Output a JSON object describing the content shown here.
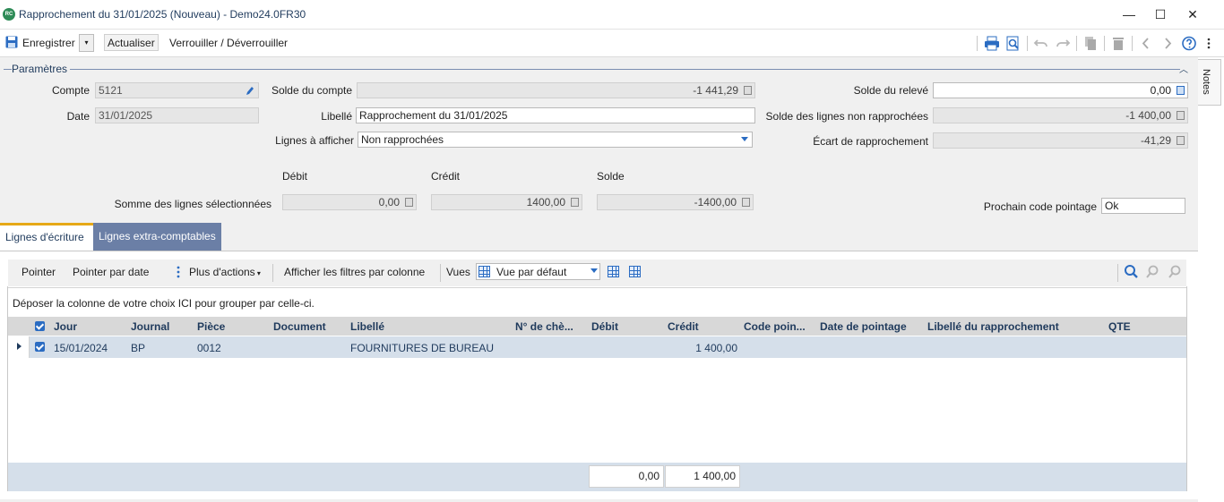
{
  "window": {
    "logo_text": "RC",
    "title": "Rapprochement du 31/01/2025 (Nouveau) - Demo24.0FR30",
    "controls": [
      "—",
      "☐",
      "✕"
    ]
  },
  "toolbar": {
    "save_label": "Enregistrer",
    "refresh_label": "Actualiser",
    "lock_label": "Verrouiller / Déverrouiller"
  },
  "notes": {
    "label": "Notes"
  },
  "params": {
    "section_title": "Paramètres",
    "compte_label": "Compte",
    "compte_value": "5121",
    "date_label": "Date",
    "date_value": "31/01/2025",
    "solde_compte_label": "Solde du compte",
    "solde_compte_value": "-1 441,29",
    "libelle_label": "Libellé",
    "libelle_value": "Rapprochement du 31/01/2025",
    "lignes_label": "Lignes à afficher",
    "lignes_value": "Non rapprochées",
    "solde_releve_label": "Solde du relevé",
    "solde_releve_value": "0,00",
    "solde_non_rapp_label": "Solde des lignes non rapprochées",
    "solde_non_rapp_value": "-1 400,00",
    "ecart_label": "Écart de rapprochement",
    "ecart_value": "-41,29",
    "debit_header": "Débit",
    "credit_header": "Crédit",
    "solde_header": "Solde",
    "somme_label": "Somme des lignes sélectionnées",
    "somme_debit": "0,00",
    "somme_credit": "1400,00",
    "somme_solde": "-1400,00",
    "prochain_label": "Prochain code pointage",
    "prochain_value": "Ok"
  },
  "tabs": [
    {
      "label": "Lignes d'écriture",
      "active": true
    },
    {
      "label": "Lignes extra-comptables",
      "active": false
    }
  ],
  "grid_toolbar": {
    "pointer": "Pointer",
    "pointer_date": "Pointer par date",
    "more_actions": "Plus d'actions",
    "filters": "Afficher les filtres par colonne",
    "vues_label": "Vues",
    "vues_value": "Vue par défaut"
  },
  "group_hint": "Déposer la colonne de votre choix ICI pour grouper par celle-ci.",
  "columns": [
    "Jour",
    "Journal",
    "Pièce",
    "Document",
    "Libellé",
    "N° de chè...",
    "Débit",
    "Crédit",
    "Code poin...",
    "Date de pointage",
    "Libellé du rapprochement",
    "QTE"
  ],
  "rows": [
    {
      "jour": "15/01/2024",
      "journal": "BP",
      "piece": "0012",
      "document": "",
      "libelle": "FOURNITURES DE BUREAU",
      "num_cheque": "",
      "debit": "",
      "credit": "1 400,00",
      "code_pointage": "",
      "date_pointage": "",
      "libelle_rapprochement": "",
      "qte": ""
    }
  ],
  "totals": {
    "debit": "0,00",
    "credit": "1 400,00"
  },
  "colors": {
    "accent": "#2b6cc2",
    "tab_active_border": "#e6a817",
    "tab_inactive_bg": "#6b7fa6",
    "row_selected": "#d5dfea"
  }
}
